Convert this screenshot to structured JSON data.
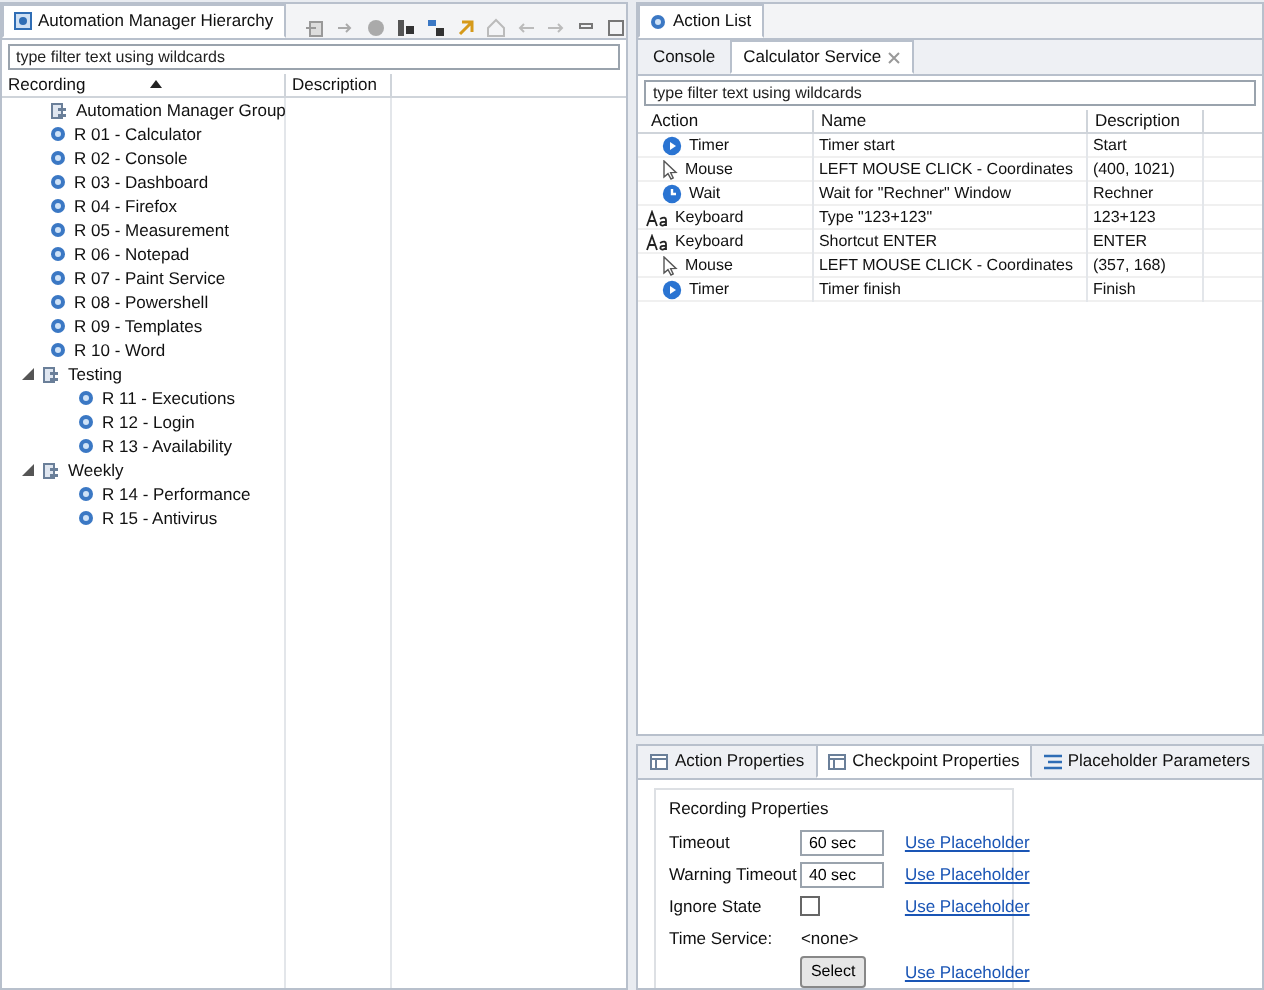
{
  "hierarchy": {
    "title": "Automation Manager Hierarchy",
    "filter": {
      "placeholder": "type filter text using wildcards"
    },
    "columns": [
      {
        "label": "Recording",
        "sorted": true
      },
      {
        "label": "Description",
        "sorted": false
      }
    ],
    "tree": [
      {
        "kind": "group",
        "label": "Automation Manager Group"
      },
      {
        "kind": "recording",
        "label": "R 01 - Calculator"
      },
      {
        "kind": "recording",
        "label": "R 02 - Console"
      },
      {
        "kind": "recording",
        "label": "R 03 - Dashboard"
      },
      {
        "kind": "recording",
        "label": "R 04 - Firefox"
      },
      {
        "kind": "recording",
        "label": "R 05 - Measurement"
      },
      {
        "kind": "recording",
        "label": "R 06 - Notepad"
      },
      {
        "kind": "recording",
        "label": "R 07 - Paint Service"
      },
      {
        "kind": "recording",
        "label": "R 08 - Powershell"
      },
      {
        "kind": "recording",
        "label": "R 09 - Templates"
      },
      {
        "kind": "recording",
        "label": "R 10 - Word"
      },
      {
        "kind": "group",
        "label": "Testing",
        "expanded": true,
        "children": [
          {
            "kind": "recording",
            "label": "R 11 - Executions"
          },
          {
            "kind": "recording",
            "label": "R 12 - Login"
          },
          {
            "kind": "recording",
            "label": "R 13 - Availability"
          }
        ]
      },
      {
        "kind": "group",
        "label": "Weekly",
        "expanded": true,
        "children": [
          {
            "kind": "recording",
            "label": "R 14 - Performance"
          },
          {
            "kind": "recording",
            "label": "R 15 - Antivirus"
          }
        ]
      }
    ]
  },
  "action_list": {
    "title": "Action List",
    "tabs": [
      {
        "label": "Console",
        "selected": false,
        "closable": false
      },
      {
        "label": "Calculator Service",
        "selected": true,
        "closable": true
      }
    ],
    "filter": {
      "placeholder": "type filter text using wildcards"
    },
    "columns": [
      "Action",
      "Name",
      "Description"
    ],
    "rows": [
      {
        "kind": "timer",
        "action": "Timer",
        "name": "Timer start",
        "description": "Start"
      },
      {
        "kind": "mouse",
        "action": "Mouse",
        "name": "LEFT MOUSE CLICK - Coordinates",
        "description": "(400, 1021)"
      },
      {
        "kind": "wait",
        "action": "Wait",
        "name": "Wait for \"Rechner\" Window",
        "description": "Rechner"
      },
      {
        "kind": "keyboard",
        "action": "Keyboard",
        "name": "Type \"123+123\"",
        "description": "123+123"
      },
      {
        "kind": "keyboard",
        "action": "Keyboard",
        "name": "Shortcut ENTER",
        "description": "ENTER"
      },
      {
        "kind": "mouse",
        "action": "Mouse",
        "name": "LEFT MOUSE CLICK - Coordinates",
        "description": "(357, 168)"
      },
      {
        "kind": "timer",
        "action": "Timer",
        "name": "Timer finish",
        "description": "Finish"
      }
    ]
  },
  "properties": {
    "tabs": [
      {
        "kind": "table",
        "label": "Action Properties",
        "selected": false
      },
      {
        "kind": "table",
        "label": "Checkpoint Properties",
        "selected": true
      },
      {
        "kind": "list",
        "label": "Placeholder Parameters",
        "selected": false
      }
    ],
    "group_title": "Recording Properties",
    "fields": [
      {
        "kind": "input",
        "label": "Timeout",
        "value": "60 sec",
        "link": "Use Placeholder"
      },
      {
        "kind": "input",
        "label": "Warning Timeout",
        "value": "40 sec",
        "link": "Use Placeholder"
      },
      {
        "kind": "checkbox",
        "label": "Ignore State",
        "checked": false,
        "link": "Use Placeholder"
      },
      {
        "kind": "text",
        "label": "Time Service:",
        "value": "<none>"
      },
      {
        "kind": "button",
        "value": "Select",
        "link": "Use Placeholder"
      }
    ]
  }
}
